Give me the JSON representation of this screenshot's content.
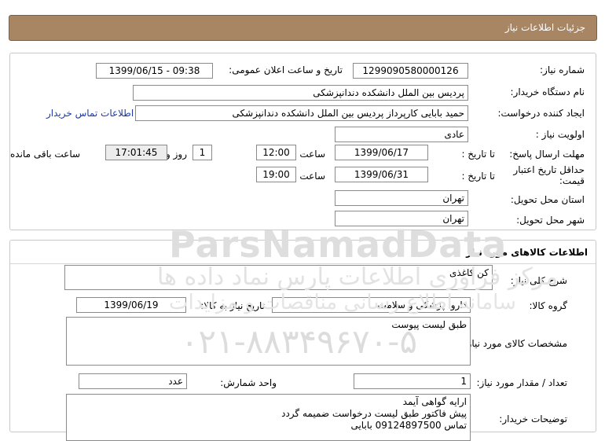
{
  "header": {
    "title": "جزئیات اطلاعات نیاز"
  },
  "need_info": {
    "need_number_label": "شماره نیاز:",
    "need_number": "1299090580000126",
    "announce_label": "تاریخ و ساعت اعلان عمومی:",
    "announce_value": "1399/06/15 - 09:38",
    "buyer_org_label": "نام دستگاه خریدار:",
    "buyer_org": "پردیس بین الملل دانشکده دندانپزشکی",
    "creator_label": "ایجاد کننده درخواست:",
    "creator": "حمید بابایی کارپرداز پردیس بین الملل دانشکده دندانپزشکی",
    "contact_link": "اطلاعات تماس خریدار",
    "priority_label": "اولویت نیاز :",
    "priority": "عادی",
    "deadline_label": "مهلت ارسال پاسخ:",
    "to_date_label": "تا تاریخ :",
    "deadline_date": "1399/06/17",
    "time_label": "ساعت",
    "deadline_time": "12:00",
    "days_value": "1",
    "days_label": "روز و",
    "remaining_time": "17:01:45",
    "remaining_label": "ساعت باقی مانده",
    "validity_label": "حداقل تاریخ اعتبار قیمت:",
    "validity_date": "1399/06/31",
    "validity_time": "19:00",
    "province_label": "استان محل تحویل:",
    "province": "تهران",
    "city_label": "شهر محل تحویل:",
    "city": "تهران"
  },
  "goods": {
    "section_title": "اطلاعات کالاهای مورد نیاز",
    "summary_label": "شرح کلی نیاز:",
    "summary": "کن کاغذی",
    "group_label": "گروه کالا:",
    "group": "دارو، پزشکی و سلامت",
    "need_date_label": "تاریخ نیاز به کالا:",
    "need_date": "1399/06/19",
    "specs_label": "مشخصات کالای مورد نیاز:",
    "specs": "طبق لیست پیوست",
    "qty_label": "تعداد / مقدار مورد نیاز:",
    "qty": "1",
    "unit_label": "واحد شمارش:",
    "unit": "عدد",
    "notes_label": "توضیحات خریدار:",
    "notes_lines": [
      "ارایه گواهی آیمد",
      "پیش فاکتور طبق لیست درخواست ضمیمه گردد",
      "تماس 09124897500  بابایی"
    ]
  },
  "watermark": {
    "line1": "ParsNamadData",
    "line2": "مرکز فراوری اطلاعات پارس نماد داده ها",
    "line3": "سامانه اطلاع رسانی مناقصات و مزایدات",
    "line4": "۰۲۱-۸۸۳۴۹۶۷۰-۵"
  }
}
